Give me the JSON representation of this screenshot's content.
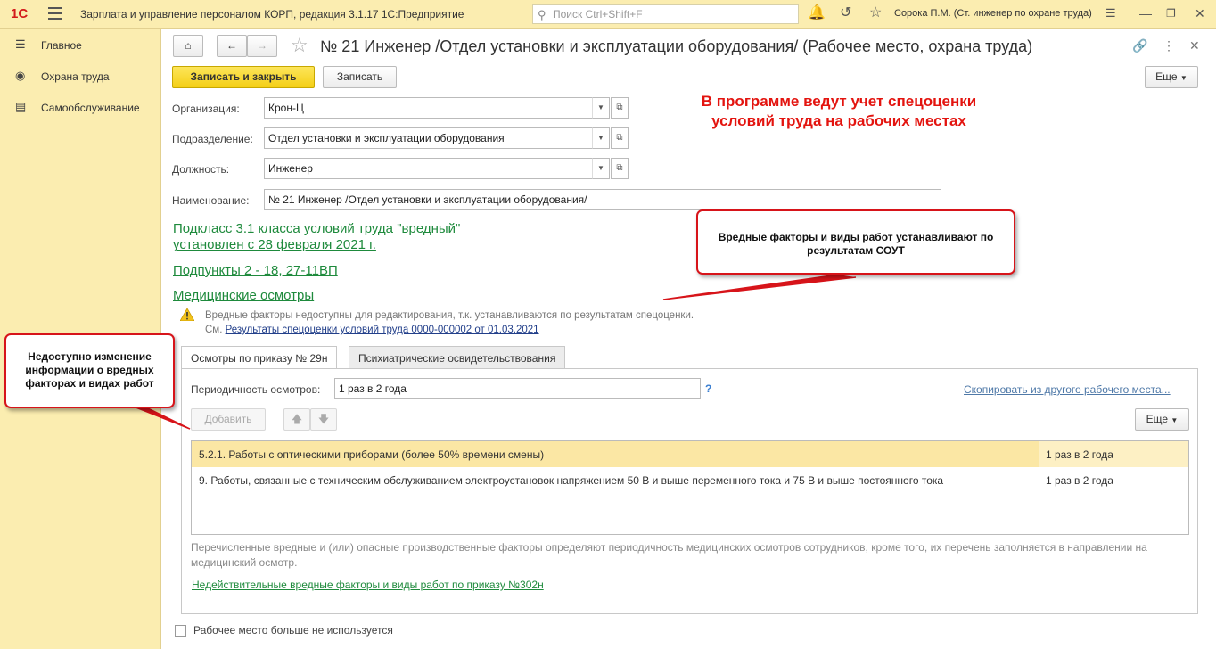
{
  "topbar": {
    "logo": "1С",
    "title": "Зарплата и управление персоналом КОРП, редакция 3.1.17 1С:Предприятие",
    "search_placeholder": "Поиск Ctrl+Shift+F",
    "user": "Сорока П.М. (Ст. инженер по охране труда)"
  },
  "sidebar": {
    "items": [
      {
        "label": "Главное",
        "icon": "menu-lines-icon"
      },
      {
        "label": "Охрана труда",
        "icon": "hard-hat-icon"
      },
      {
        "label": "Самообслуживание",
        "icon": "id-card-icon"
      }
    ]
  },
  "form": {
    "title": "№ 21 Инженер /Отдел установки и эксплуатации оборудования/ (Рабочее место, охрана труда)",
    "save_close_label": "Записать и закрыть",
    "save_label": "Записать",
    "more_label": "Еще",
    "fields": {
      "org_label": "Организация:",
      "org_value": "Крон-Ц",
      "dept_label": "Подразделение:",
      "dept_value": "Отдел установки и эксплуатации оборудования",
      "pos_label": "Должность:",
      "pos_value": "Инженер",
      "name_label": "Наименование:",
      "name_value": "№ 21 Инженер /Отдел установки и эксплуатации оборудования/"
    },
    "links": {
      "subclass_line1": "Подкласс 3.1 класса условий труда \"вредный\"",
      "subclass_line2": "установлен с 28 февраля 2021 г.",
      "subitems": "Подпункты 2 - 18, 27-11ВП",
      "medical": "Медицинские осмотры"
    },
    "warning_text": "Вредные факторы недоступны для редактирования, т.к. устанавливаются по результатам спецоценки.",
    "see_prefix": "См.",
    "see_link": "Результаты спецоценки условий труда 0000-000002 от 01.03.2021",
    "tabs": [
      "Осмотры по приказу № 29н",
      "Психиатрические освидетельствования"
    ],
    "periodicity_label": "Периодичность осмотров:",
    "periodicity_value": "1 раз в 2 года",
    "help_mark": "?",
    "copy_link": "Скопировать из другого рабочего места...",
    "add_label": "Добавить",
    "grid_more_label": "Еще",
    "rows": [
      {
        "name": "5.2.1. Работы с оптическими приборами (более 50% времени смены)",
        "period": "1 раз в 2 года"
      },
      {
        "name": "9. Работы, связанные с техническим обслуживанием электроустановок напряжением 50 В и выше переменного тока и 75 В и выше постоянного тока",
        "period": "1 раз в 2 года"
      }
    ],
    "note": "Перечисленные вредные и (или) опасные производственные факторы определяют периодичность медицинских осмотров сотрудников, кроме того, их перечень заполняется в направлении на медицинский осмотр.",
    "invalid_link": "Недействительные вредные факторы и виды работ по приказу №302н",
    "unused_checkbox": "Рабочее место больше не используется"
  },
  "annotations": {
    "red_line1": "В программе ведут учет спецоценки",
    "red_line2": "условий труда на рабочих местах",
    "callout_right": "Вредные факторы и виды работ устанавливают по результатам СОУТ",
    "callout_left": "Недоступно изменение информации о вредных факторах и видах работ"
  }
}
